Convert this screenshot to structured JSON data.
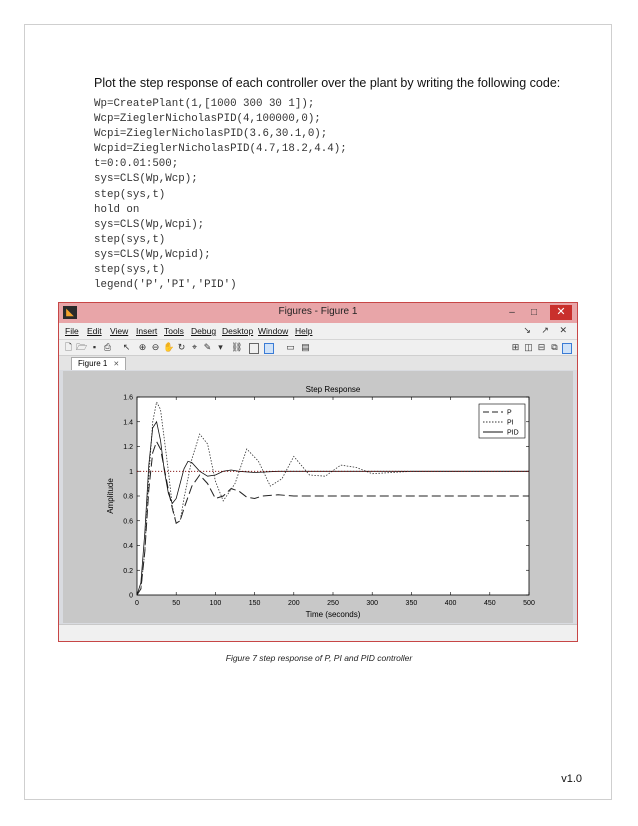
{
  "document": {
    "intro_text": "Plot the step response of each controller over the plant by writing the following code:",
    "code_lines": [
      "Wp=CreatePlant(1,[1000 300 30 1]);",
      "Wcp=ZieglerNicholasPID(4,100000,0);",
      "Wcpi=ZieglerNicholasPID(3.6,30.1,0);",
      "Wcpid=ZieglerNicholasPID(4.7,18.2,4.4);",
      "t=0:0.01:500;",
      "sys=CLS(Wp,Wcp);",
      "step(sys,t)",
      "hold on",
      "sys=CLS(Wp,Wcpi);",
      "step(sys,t)",
      "sys=CLS(Wp,Wcpid);",
      "step(sys,t)",
      "legend('P','PI','PID')"
    ],
    "caption": "Figure 7 step response of P, PI and PID controller",
    "version": "v1.0"
  },
  "window": {
    "title": "Figures - Figure 1",
    "app_icon": "matlab-icon",
    "minimize_label": "–",
    "maximize_label": "□",
    "close_label": "✕",
    "menu": [
      "File",
      "Edit",
      "View",
      "Insert",
      "Tools",
      "Debug",
      "Desktop",
      "Window",
      "Help"
    ],
    "menu_right": "↘ ↗ ✕",
    "tab_label": "Figure 1",
    "tab_close": "✕",
    "toolbar_icons": [
      "new-file-icon",
      "open-folder-icon",
      "save-icon",
      "print-icon",
      "arrow-pointer-icon",
      "zoom-in-icon",
      "zoom-out-icon",
      "pan-icon",
      "rotate-icon",
      "data-cursor-icon",
      "brush-icon",
      "link-icon",
      "colorbar-icon",
      "legend-icon",
      "hide-plot-tools-icon",
      "show-plot-tools-icon"
    ],
    "layout_icons": [
      "tile-icon",
      "left-right-icon",
      "top-bottom-icon",
      "float-icon",
      "dock-icon"
    ]
  },
  "chart_data": {
    "type": "line",
    "title": "Step Response",
    "xlabel": "Time (seconds)",
    "ylabel": "Amplitude",
    "xlim": [
      0,
      500
    ],
    "ylim": [
      0,
      1.6
    ],
    "xticks": [
      "0",
      "50",
      "100",
      "150",
      "200",
      "250",
      "300",
      "350",
      "400",
      "450",
      "500"
    ],
    "yticks": [
      "0",
      "0.2",
      "0.4",
      "0.6",
      "0.8",
      "1",
      "1.2",
      "1.4",
      "1.6"
    ],
    "grid": false,
    "legend_position": "top-right",
    "series": [
      {
        "name": "P",
        "style": "dashed",
        "x": [
          0,
          5,
          10,
          15,
          20,
          25,
          30,
          40,
          45,
          50,
          55,
          60,
          70,
          80,
          90,
          100,
          110,
          120,
          130,
          140,
          150,
          160,
          180,
          200,
          240,
          300,
          400,
          500
        ],
        "y": [
          0,
          0.05,
          0.35,
          0.85,
          1.15,
          1.24,
          1.18,
          0.85,
          0.7,
          0.58,
          0.6,
          0.7,
          0.88,
          0.97,
          0.9,
          0.78,
          0.8,
          0.86,
          0.84,
          0.79,
          0.78,
          0.8,
          0.81,
          0.8,
          0.8,
          0.8,
          0.8,
          0.8
        ]
      },
      {
        "name": "PI",
        "style": "dotted",
        "x": [
          0,
          5,
          10,
          15,
          20,
          25,
          30,
          40,
          45,
          50,
          55,
          60,
          70,
          80,
          90,
          100,
          110,
          125,
          140,
          155,
          170,
          185,
          200,
          220,
          240,
          260,
          280,
          300,
          350,
          400,
          500
        ],
        "y": [
          0,
          0.05,
          0.35,
          0.95,
          1.4,
          1.56,
          1.5,
          1.0,
          0.72,
          0.58,
          0.6,
          0.78,
          1.1,
          1.3,
          1.22,
          0.92,
          0.76,
          0.9,
          1.18,
          1.08,
          0.88,
          0.94,
          1.12,
          0.97,
          0.96,
          1.05,
          1.03,
          0.98,
          1.0,
          1.0,
          1.0
        ]
      },
      {
        "name": "PID",
        "style": "solid",
        "x": [
          0,
          5,
          10,
          15,
          20,
          25,
          30,
          35,
          40,
          45,
          50,
          55,
          60,
          65,
          70,
          80,
          90,
          100,
          110,
          120,
          130,
          150,
          180,
          220,
          300,
          400,
          500
        ],
        "y": [
          0,
          0.1,
          0.5,
          1.05,
          1.35,
          1.4,
          1.25,
          1.0,
          0.82,
          0.74,
          0.78,
          0.9,
          1.02,
          1.08,
          1.07,
          1.0,
          0.96,
          0.97,
          1.0,
          1.01,
          1.0,
          0.99,
          1.0,
          1.0,
          1.0,
          1.0,
          1.0
        ]
      },
      {
        "name": "",
        "style": "dotted-reference",
        "x": [
          0,
          500
        ],
        "y": [
          1,
          1
        ]
      }
    ]
  }
}
